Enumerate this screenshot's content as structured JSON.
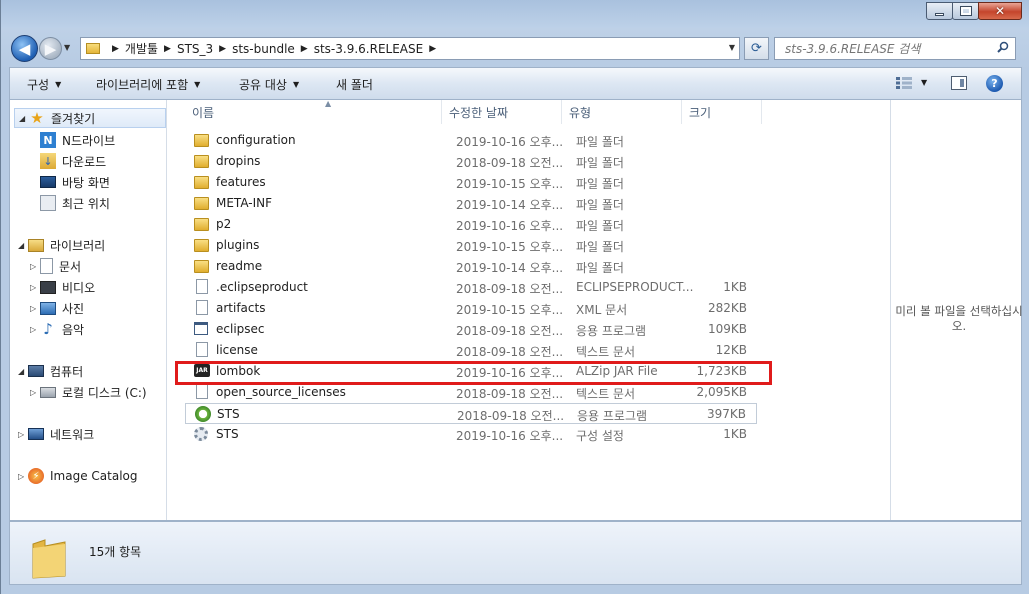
{
  "titlebar": {
    "menu_fragment": "~ ··· ·· ·· ·· ·· ··· ··· ·· ·· ·· ·· ···",
    "minimize": "",
    "maximize": "",
    "close": ""
  },
  "address": {
    "crumbs": [
      "개발툴",
      "STS_3",
      "sts-bundle",
      "sts-3.9.6.RELEASE"
    ]
  },
  "search": {
    "placeholder": "sts-3.9.6.RELEASE 검색"
  },
  "toolbar": {
    "organize": "구성",
    "include_library": "라이브러리에 포함",
    "share": "공유 대상",
    "new_folder": "새 폴더"
  },
  "nav": {
    "favorites": "즐겨찾기",
    "ndrive": "N드라이브",
    "downloads": "다운로드",
    "desktop": "바탕 화면",
    "recent": "최근 위치",
    "libraries": "라이브러리",
    "documents": "문서",
    "videos": "비디오",
    "pictures": "사진",
    "music": "음악",
    "computer": "컴퓨터",
    "local_disk": "로컬 디스크 (C:)",
    "network": "네트워크",
    "image_catalog": "Image Catalog"
  },
  "columns": {
    "name": "이름",
    "date": "수정한 날짜",
    "type": "유형",
    "size": "크기"
  },
  "files": [
    {
      "name": "configuration",
      "date": "2019-10-16 오후...",
      "type": "파일 폴더",
      "size": "",
      "icon": "folder-icon"
    },
    {
      "name": "dropins",
      "date": "2018-09-18 오전...",
      "type": "파일 폴더",
      "size": "",
      "icon": "folder-icon"
    },
    {
      "name": "features",
      "date": "2019-10-15 오후...",
      "type": "파일 폴더",
      "size": "",
      "icon": "folder-icon"
    },
    {
      "name": "META-INF",
      "date": "2019-10-14 오후...",
      "type": "파일 폴더",
      "size": "",
      "icon": "folder-icon"
    },
    {
      "name": "p2",
      "date": "2019-10-16 오후...",
      "type": "파일 폴더",
      "size": "",
      "icon": "folder-icon"
    },
    {
      "name": "plugins",
      "date": "2019-10-15 오후...",
      "type": "파일 폴더",
      "size": "",
      "icon": "folder-icon"
    },
    {
      "name": "readme",
      "date": "2019-10-14 오후...",
      "type": "파일 폴더",
      "size": "",
      "icon": "folder-icon"
    },
    {
      "name": ".eclipseproduct",
      "date": "2018-09-18 오전...",
      "type": "ECLIPSEPRODUCT...",
      "size": "1KB",
      "icon": "document-icon"
    },
    {
      "name": "artifacts",
      "date": "2019-10-15 오후...",
      "type": "XML 문서",
      "size": "282KB",
      "icon": "document-icon"
    },
    {
      "name": "eclipsec",
      "date": "2018-09-18 오전...",
      "type": "응용 프로그램",
      "size": "109KB",
      "icon": "application-icon"
    },
    {
      "name": "license",
      "date": "2018-09-18 오전...",
      "type": "텍스트 문서",
      "size": "12KB",
      "icon": "document-icon"
    },
    {
      "name": "lombok",
      "date": "2019-10-16 오후...",
      "type": "ALZip JAR File",
      "size": "1,723KB",
      "icon": "jar-icon"
    },
    {
      "name": "open_source_licenses",
      "date": "2018-09-18 오전...",
      "type": "텍스트 문서",
      "size": "2,095KB",
      "icon": "document-icon"
    },
    {
      "name": "STS",
      "date": "2018-09-18 오전...",
      "type": "응용 프로그램",
      "size": "397KB",
      "icon": "sts-icon"
    },
    {
      "name": "STS",
      "date": "2019-10-16 오후...",
      "type": "구성 설정",
      "size": "1KB",
      "icon": "settings-icon"
    }
  ],
  "preview": {
    "text": "미리 볼 파일을 선택하십시오."
  },
  "details": {
    "count": "15개 항목"
  },
  "colors": {
    "highlight": "#e01b1b",
    "window_frame": "#b9cce3",
    "folder": "#e8bb45"
  }
}
